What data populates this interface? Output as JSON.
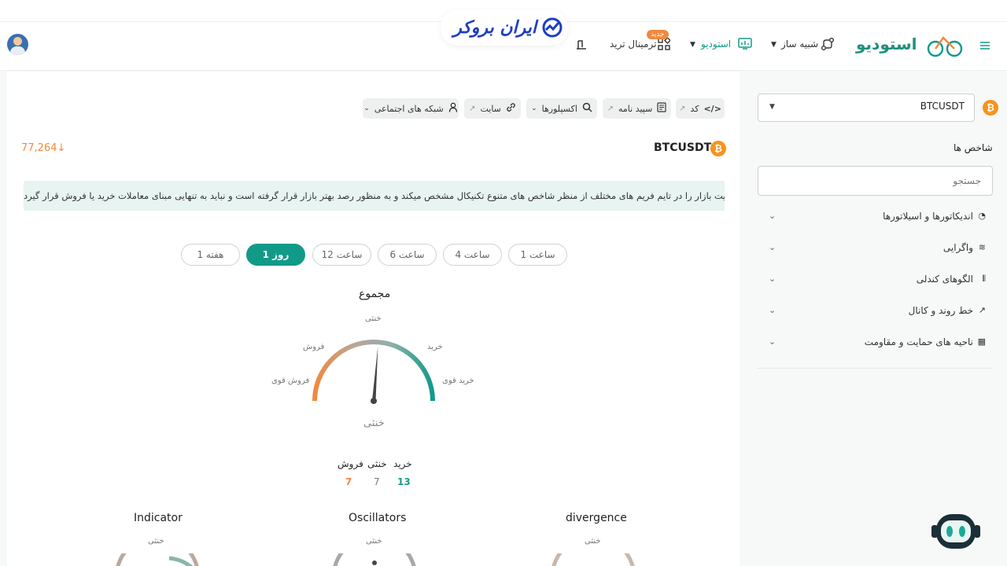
{
  "header": {
    "brand": "ایران بروکر",
    "studio_logo_text": "استودیو",
    "nav": {
      "terminal": "ترمینال ترید",
      "new_badge": "جدید",
      "studio": "استودیو",
      "simulator": "شبیه ساز"
    }
  },
  "toolbar": {
    "code": "کد",
    "whitepaper": "سپید نامه",
    "explorers": "اکسپلورها",
    "site": "سایت",
    "social": "شبکه های اجتماعی"
  },
  "symbol": {
    "name": "BTCUSDT",
    "price": "77,264",
    "price_arrow": "↓"
  },
  "notice": "این قسمت وضعیت بازار را در تایم فریم های مختلف از منظر شاخص های متنوع تکنیکال مشخص میکند و به منظور رصد بهتر بازار قرار گرفته است و نباید به تنهایی مبنای معاملات خرید یا فروش قرار گیرد.",
  "timeframes": [
    {
      "label": "1 ساعت",
      "active": false
    },
    {
      "label": "4 ساعت",
      "active": false
    },
    {
      "label": "6 ساعت",
      "active": false
    },
    {
      "label": "12 ساعت",
      "active": false
    },
    {
      "label": "1 روز",
      "active": true
    },
    {
      "label": "1 هفته",
      "active": false
    }
  ],
  "summary_gauge": {
    "title": "مجموع",
    "labels": {
      "neutral": "خنثی",
      "sell": "فروش",
      "buy": "خرید",
      "strong_sell": "فروش قوی",
      "strong_buy": "خرید قوی"
    },
    "result": "خنثی",
    "needle_level": 0.52
  },
  "counts": {
    "buy_label": "خرید",
    "neutral_label": "خنثی",
    "sell_label": "فروش",
    "buy": "13",
    "neutral": "7",
    "sell": "7"
  },
  "sub_gauges": [
    {
      "title": "Indicator",
      "top_label": "خنثی"
    },
    {
      "title": "Oscillators",
      "top_label": "خنثی"
    },
    {
      "title": "divergence",
      "top_label": "خنثی"
    }
  ],
  "sidebar": {
    "symbol": "BTCUSDT",
    "title": "شاخص ها",
    "search_placeholder": "جستجو",
    "categories": [
      {
        "label": "اندیکاتورها و اسیلاتورها",
        "icon": "gauge-icon"
      },
      {
        "label": "واگرایی",
        "icon": "wave-icon"
      },
      {
        "label": "الگوهای کندلی",
        "icon": "candles-icon"
      },
      {
        "label": "خط روند و کانال",
        "icon": "trend-icon"
      },
      {
        "label": "ناحیه های حمایت و مقاومت",
        "icon": "grid-icon"
      }
    ]
  },
  "colors": {
    "accent": "#129a88",
    "sell": "#f0893e",
    "buy": "#1a9b89",
    "bitcoin": "#f7931a"
  }
}
